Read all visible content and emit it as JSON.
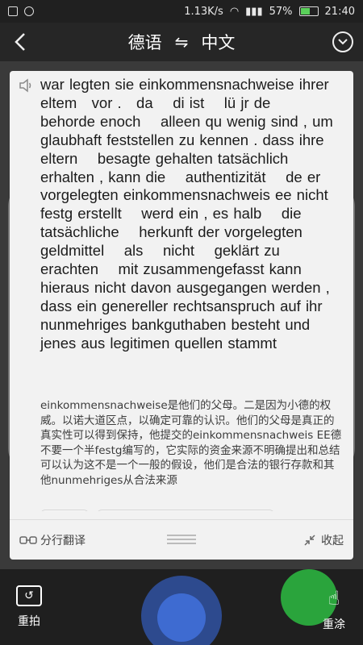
{
  "status_bar": {
    "speed": "1.13K/s",
    "battery": "57%",
    "battery_level": 0.57,
    "time": "21:40"
  },
  "header": {
    "source_lang": "德语",
    "swap_icon": "⇋",
    "target_lang": "中文"
  },
  "card": {
    "source_text": "war legten sie einkommensnachweise ihrer eltem   vor .   da    di ist    lü jr de    behorde enoch    alleen qu wenig sind , um glaubhaft feststellen zu kennen . dass ihre eltern    besagte gehalten tatsächlich erhalten , kann die    authentizität    de er    vorgelegten einkommensnachweis ee nicht    festg erstellt    werd ein , es halb    die tatsächliche    herkunft der vorgelegten geldmittel    als    nicht    geklärt zu erachten    mit zusammengefasst kann hieraus nicht davon ausgegangen werden , dass ein genereller rechtsanspruch auf ihr nunmehriges bankguthaben besteht und    jenes aus legitimen quellen stammt",
    "target_text": "einkommensnachweise是他们的父母。二是因为小德的权威。以诺大道区点，以确定可靠的认识。他们的父母是真正的真实性可以得到保持，他提交的einkommensnachweis EE德不要一个半festg编写的，它实际的资金来源不明确提出和总结可以认为这不是一个一般的假设，他们是合法的银行存款和其他nunmehriges从合法来源"
  },
  "footer": {
    "split_label": "分行翻译",
    "collapse_label": "收起"
  },
  "bottom": {
    "retake_label": "重拍",
    "repaint_label": "重涂"
  }
}
